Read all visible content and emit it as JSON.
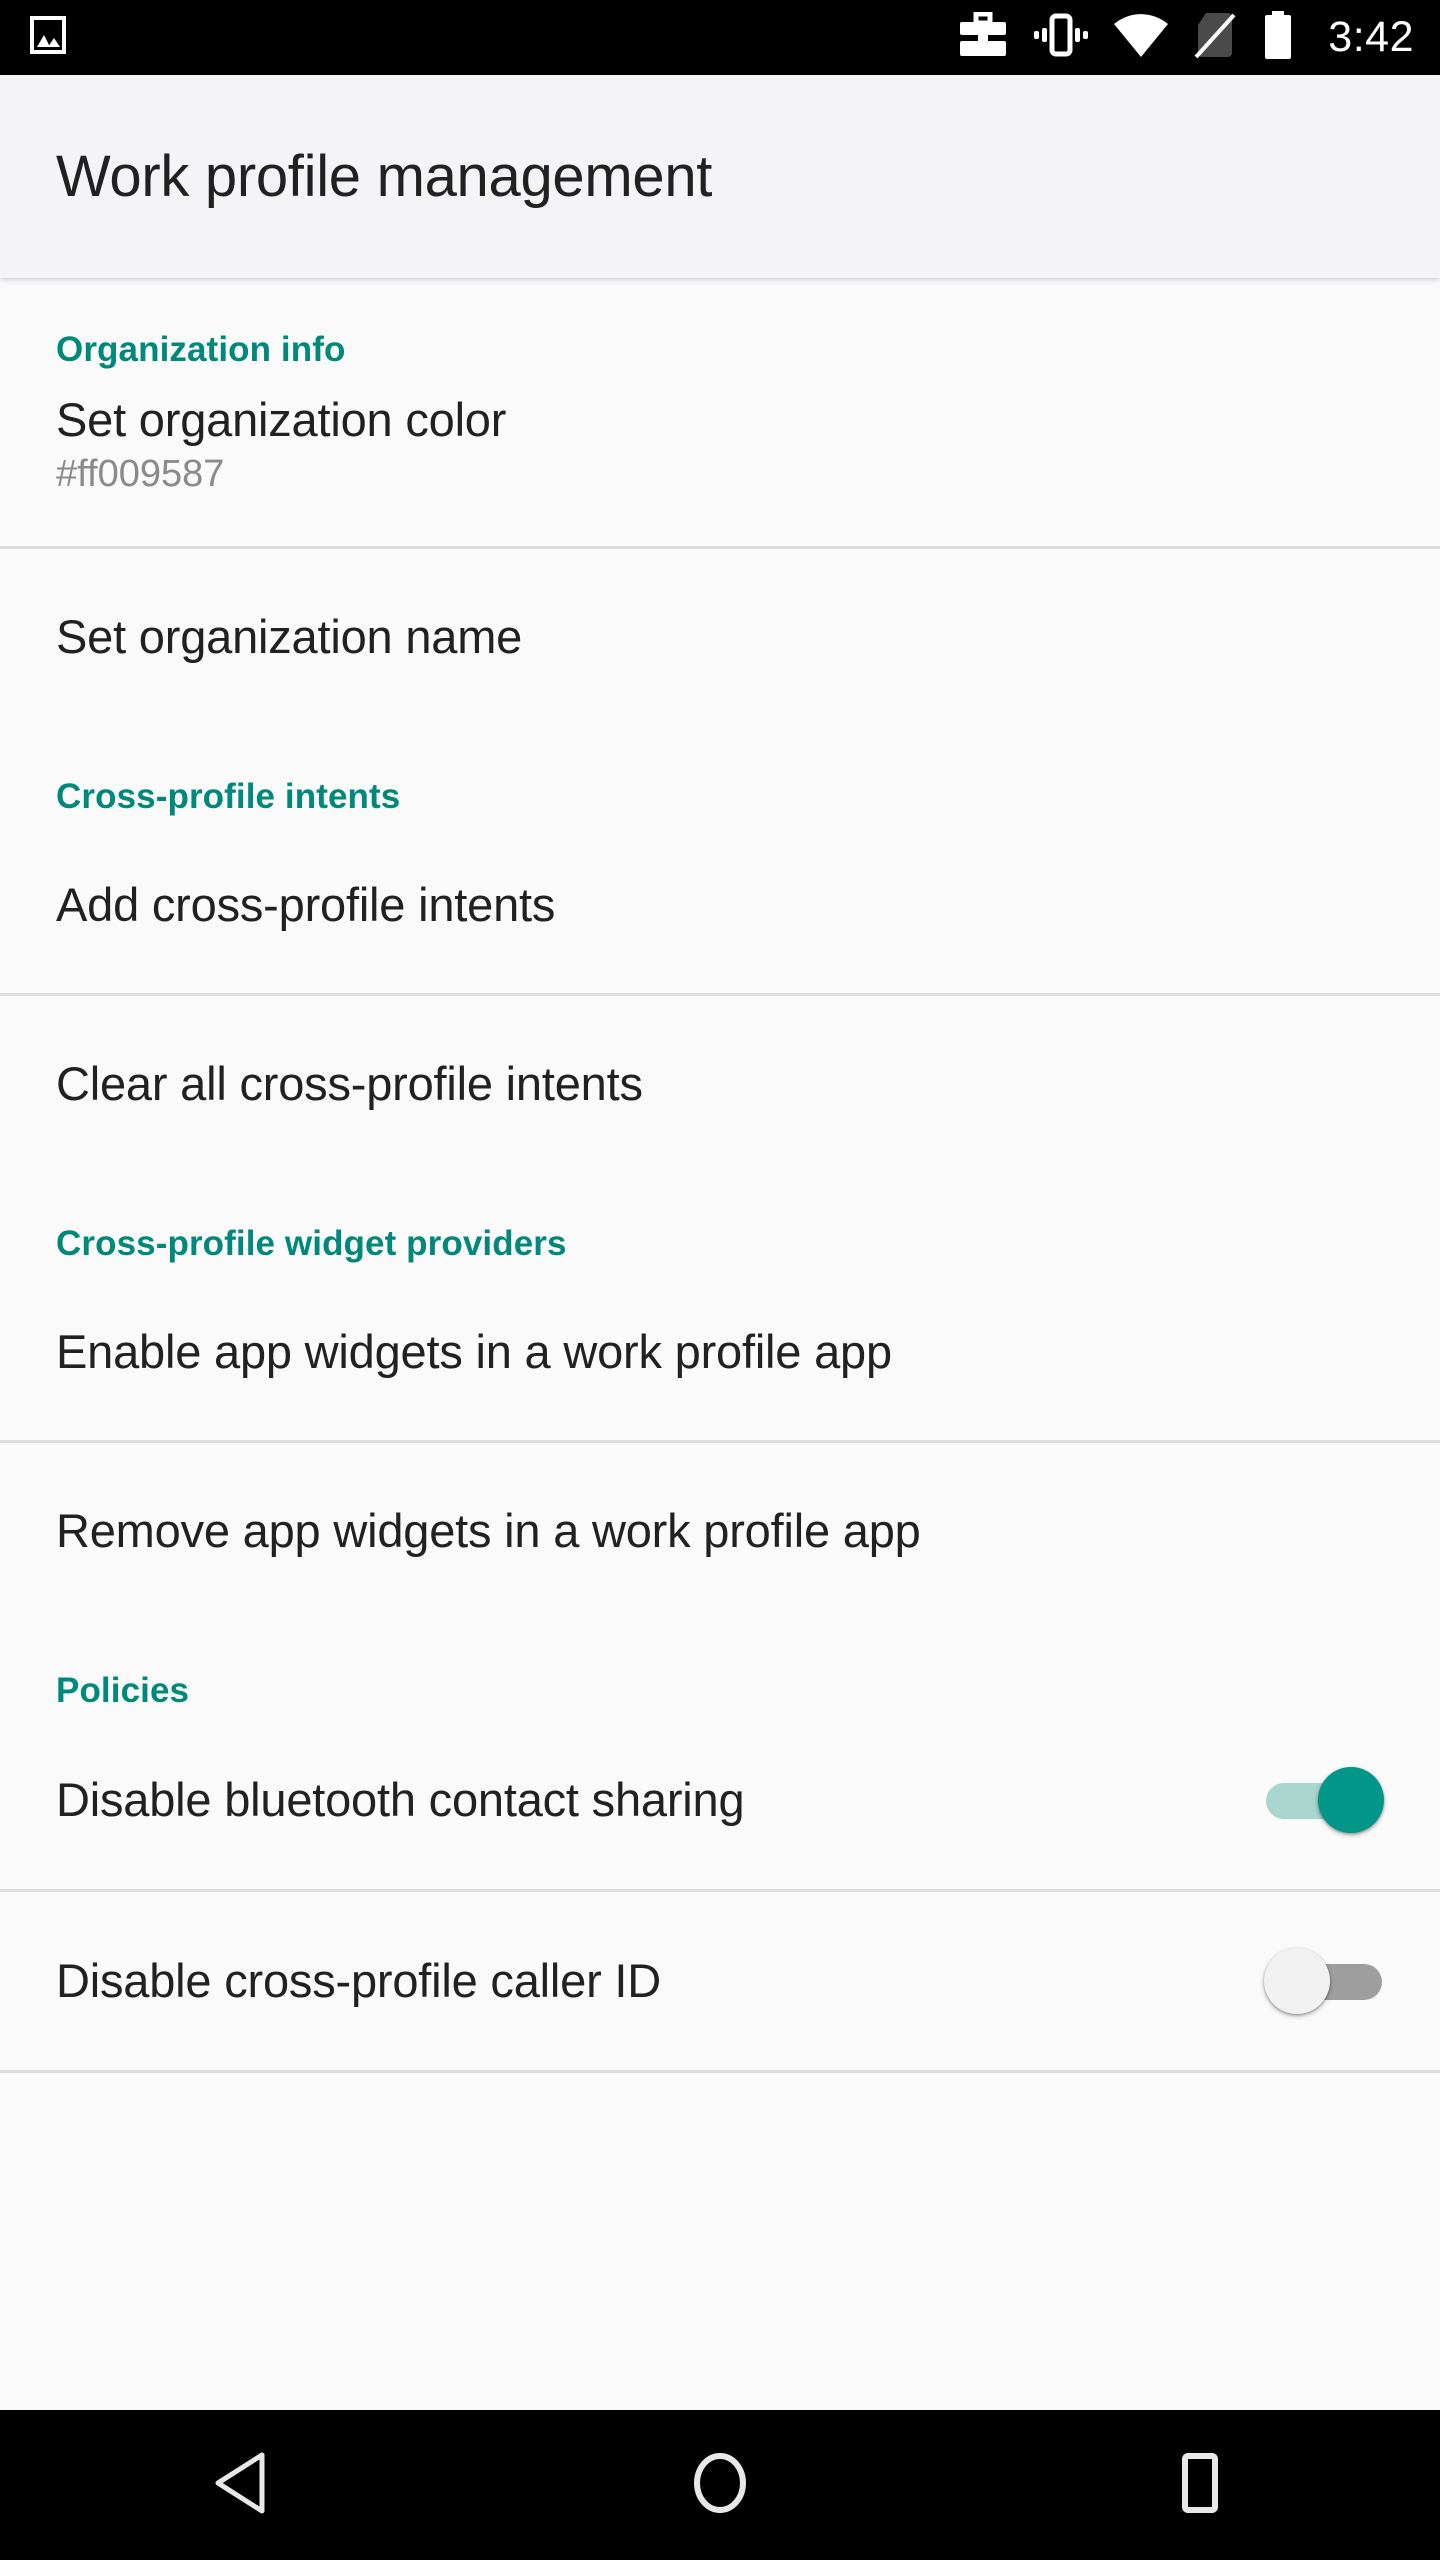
{
  "status_bar": {
    "time": "3:42",
    "left_icons": [
      {
        "name": "screenshot-image-icon"
      }
    ],
    "right_icons": [
      {
        "name": "work-profile-briefcase-icon"
      },
      {
        "name": "vibrate-icon"
      },
      {
        "name": "wifi-icon"
      },
      {
        "name": "no-sim-icon"
      },
      {
        "name": "battery-icon"
      }
    ]
  },
  "toolbar": {
    "title": "Work profile management"
  },
  "colors": {
    "accent_teal": "#00897b",
    "switch_on_thumb": "#009688",
    "switch_on_track": "#a9d5ce",
    "switch_off_track": "#9e9e9e",
    "switch_off_thumb": "#f1f1f1",
    "background": "#fafafb",
    "toolbar_background": "#f4f4f6",
    "divider": "#dcdcdd",
    "primary_text": "#212121",
    "secondary_text": "#8a8a8a",
    "status_bar_background": "#000000"
  },
  "sections": [
    {
      "header": "Organization info",
      "items": [
        {
          "title": "Set organization color",
          "summary": "#ff009587",
          "type": "link",
          "divider_after": true
        },
        {
          "title": "Set organization name",
          "summary": "",
          "type": "link",
          "divider_after": false
        }
      ]
    },
    {
      "header": "Cross-profile intents",
      "items": [
        {
          "title": "Add cross-profile intents",
          "summary": "",
          "type": "link",
          "divider_after": true
        },
        {
          "title": "Clear all cross-profile intents",
          "summary": "",
          "type": "link",
          "divider_after": false
        }
      ]
    },
    {
      "header": "Cross-profile widget providers",
      "items": [
        {
          "title": "Enable app widgets in a work profile app",
          "summary": "",
          "type": "link",
          "divider_after": true
        },
        {
          "title": "Remove app widgets in a work profile app",
          "summary": "",
          "type": "link",
          "divider_after": false
        }
      ]
    },
    {
      "header": "Policies",
      "items": [
        {
          "title": "Disable bluetooth contact sharing",
          "summary": "",
          "type": "switch",
          "checked": true,
          "divider_after": true
        },
        {
          "title": "Disable cross-profile caller ID",
          "summary": "",
          "type": "switch",
          "checked": false,
          "divider_after": true
        }
      ]
    }
  ],
  "nav_bar": {
    "buttons": [
      {
        "name": "back-button",
        "label": "Back"
      },
      {
        "name": "home-button",
        "label": "Home"
      },
      {
        "name": "recents-button",
        "label": "Recents"
      }
    ]
  }
}
